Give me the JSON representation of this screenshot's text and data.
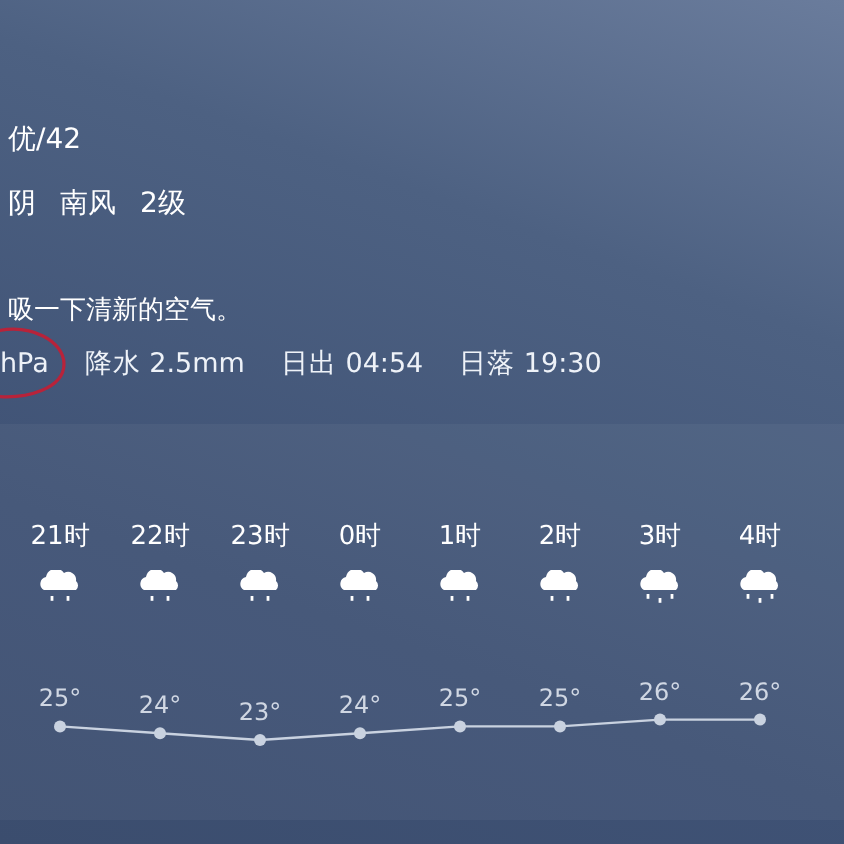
{
  "air_quality": "优/42",
  "conditions": [
    "阴",
    "南风",
    "2级"
  ],
  "tip": "吸一下清新的空气。",
  "details": [
    {
      "text": "hPa",
      "circled": true
    },
    {
      "text": "降水 2.5mm",
      "circled": false
    },
    {
      "text": "日出 04:54",
      "circled": false
    },
    {
      "text": "日落 19:30",
      "circled": false
    }
  ],
  "hourly": [
    {
      "kind": "light_rain"
    },
    {
      "kind": "light_rain"
    },
    {
      "kind": "light_rain"
    },
    {
      "kind": "light_rain"
    },
    {
      "kind": "light_rain"
    },
    {
      "kind": "light_rain"
    },
    {
      "kind": "rain"
    },
    {
      "kind": "rain"
    }
  ],
  "chart_data": {
    "type": "line",
    "categories": [
      "21时",
      "22时",
      "23时",
      "0时",
      "1时",
      "2时",
      "3时",
      "4时"
    ],
    "series": [
      {
        "color": "#c9d2e0",
        "marker": "circle",
        "values": [
          25,
          24,
          23,
          24,
          25,
          25,
          26,
          26
        ],
        "value_labels": [
          "25°",
          "24°",
          "23°",
          "24°",
          "25°",
          "25°",
          "26°",
          "26°"
        ]
      }
    ]
  }
}
